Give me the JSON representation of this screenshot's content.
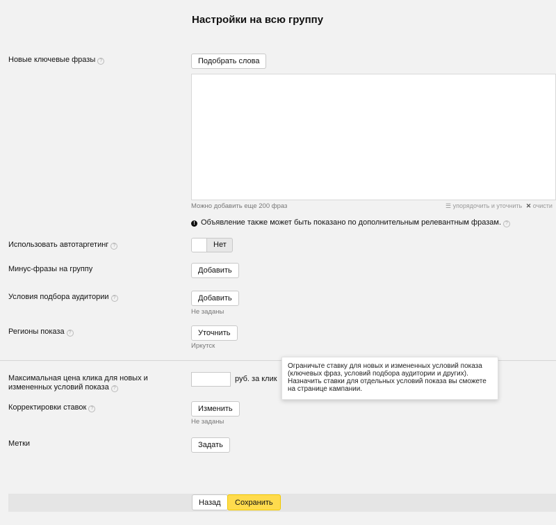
{
  "page": {
    "title": "Настройки на всю группу"
  },
  "keywords": {
    "label": "Новые ключевые фразы",
    "help": "?",
    "pick_button": "Подобрать слова",
    "hint": "Можно добавить еще 200 фраз",
    "refine_link": "упорядочить и уточнить",
    "clear_link": "очисти",
    "info_text": "Объявление также может быть показано по дополнительным релевантным фразам."
  },
  "autotargeting": {
    "label": "Использовать автотаргетинг",
    "help": "?",
    "toggle_value": "Нет"
  },
  "minus_phrases": {
    "label": "Минус-фразы на группу",
    "button": "Добавить"
  },
  "audience": {
    "label": "Условия подбора аудитории",
    "help": "?",
    "button": "Добавить",
    "status": "Не заданы"
  },
  "regions": {
    "label": "Регионы показа",
    "help": "?",
    "button": "Уточнить",
    "value": "Иркутск"
  },
  "max_price": {
    "label_line1": "Максимальная цена клика для новых и",
    "label_line2": "измененных условий показа",
    "help": "?",
    "input_value": "",
    "unit": "руб. за клик",
    "tooltip_line1": "Ограничьте ставку для новых и измененных условий показа",
    "tooltip_line2": "(ключевых фраз, условий подбора аудитории и других).",
    "tooltip_line3": "Назначить ставки для отдельных условий показа вы сможете",
    "tooltip_line4": "на странице кампании."
  },
  "bid_adjustments": {
    "label": "Корректировки ставок",
    "help": "?",
    "button": "Изменить",
    "status": "Не заданы"
  },
  "tags": {
    "label": "Метки",
    "button": "Задать"
  },
  "footer": {
    "back_button": "Назад",
    "save_button": "Сохранить"
  },
  "colors": {
    "background": "#f2f2f2",
    "save_accent": "#ffdb4d",
    "border": "#c8c8c8"
  }
}
